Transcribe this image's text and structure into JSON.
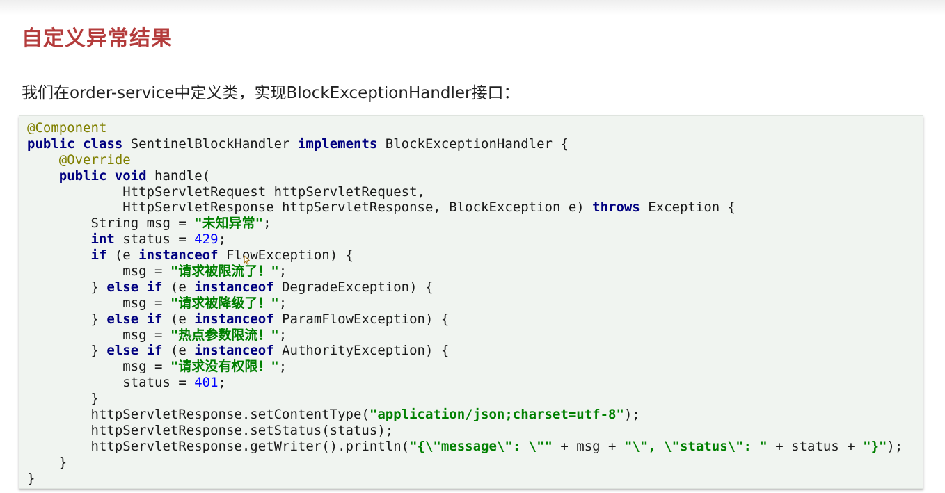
{
  "page": {
    "title": "自定义异常结果",
    "intro": "我们在order-service中定义类，实现BlockExceptionHandler接口："
  },
  "code": {
    "lines": [
      [
        {
          "t": "@Component",
          "c": "ann"
        }
      ],
      [
        {
          "t": "public ",
          "c": "kw"
        },
        {
          "t": "class ",
          "c": "kw"
        },
        {
          "t": "SentinelBlockHandler ",
          "c": ""
        },
        {
          "t": "implements ",
          "c": "kw"
        },
        {
          "t": "BlockExceptionHandler {",
          "c": ""
        }
      ],
      [
        {
          "t": "    ",
          "c": ""
        },
        {
          "t": "@Override",
          "c": "ann"
        }
      ],
      [
        {
          "t": "    ",
          "c": ""
        },
        {
          "t": "public ",
          "c": "kw"
        },
        {
          "t": "void ",
          "c": "kw"
        },
        {
          "t": "handle(",
          "c": ""
        }
      ],
      [
        {
          "t": "            HttpServletRequest httpServletRequest,",
          "c": ""
        }
      ],
      [
        {
          "t": "            HttpServletResponse httpServletResponse, BlockException e) ",
          "c": ""
        },
        {
          "t": "throws ",
          "c": "kw"
        },
        {
          "t": "Exception {",
          "c": ""
        }
      ],
      [
        {
          "t": "        String msg = ",
          "c": ""
        },
        {
          "t": "\"未知异常\"",
          "c": "str"
        },
        {
          "t": ";",
          "c": ""
        }
      ],
      [
        {
          "t": "        ",
          "c": ""
        },
        {
          "t": "int ",
          "c": "kw"
        },
        {
          "t": "status = ",
          "c": ""
        },
        {
          "t": "429",
          "c": "num"
        },
        {
          "t": ";",
          "c": ""
        }
      ],
      [
        {
          "t": "        ",
          "c": ""
        },
        {
          "t": "if ",
          "c": "kw"
        },
        {
          "t": "(e ",
          "c": ""
        },
        {
          "t": "instanceof ",
          "c": "kw"
        },
        {
          "t": "FlowException) {",
          "c": ""
        }
      ],
      [
        {
          "t": "            msg = ",
          "c": ""
        },
        {
          "t": "\"请求被限流了！\"",
          "c": "str"
        },
        {
          "t": ";",
          "c": ""
        }
      ],
      [
        {
          "t": "        } ",
          "c": ""
        },
        {
          "t": "else ",
          "c": "kw"
        },
        {
          "t": "if ",
          "c": "kw"
        },
        {
          "t": "(e ",
          "c": ""
        },
        {
          "t": "instanceof ",
          "c": "kw"
        },
        {
          "t": "DegradeException) {",
          "c": ""
        }
      ],
      [
        {
          "t": "            msg = ",
          "c": ""
        },
        {
          "t": "\"请求被降级了！\"",
          "c": "str"
        },
        {
          "t": ";",
          "c": ""
        }
      ],
      [
        {
          "t": "        } ",
          "c": ""
        },
        {
          "t": "else ",
          "c": "kw"
        },
        {
          "t": "if ",
          "c": "kw"
        },
        {
          "t": "(e ",
          "c": ""
        },
        {
          "t": "instanceof ",
          "c": "kw"
        },
        {
          "t": "ParamFlowException) {",
          "c": ""
        }
      ],
      [
        {
          "t": "            msg = ",
          "c": ""
        },
        {
          "t": "\"热点参数限流！\"",
          "c": "str"
        },
        {
          "t": ";",
          "c": ""
        }
      ],
      [
        {
          "t": "        } ",
          "c": ""
        },
        {
          "t": "else ",
          "c": "kw"
        },
        {
          "t": "if ",
          "c": "kw"
        },
        {
          "t": "(e ",
          "c": ""
        },
        {
          "t": "instanceof ",
          "c": "kw"
        },
        {
          "t": "AuthorityException) {",
          "c": ""
        }
      ],
      [
        {
          "t": "            msg = ",
          "c": ""
        },
        {
          "t": "\"请求没有权限！\"",
          "c": "str"
        },
        {
          "t": ";",
          "c": ""
        }
      ],
      [
        {
          "t": "            status = ",
          "c": ""
        },
        {
          "t": "401",
          "c": "num"
        },
        {
          "t": ";",
          "c": ""
        }
      ],
      [
        {
          "t": "        }",
          "c": ""
        }
      ],
      [
        {
          "t": "        httpServletResponse.setContentType(",
          "c": ""
        },
        {
          "t": "\"application/json;charset=utf-8\"",
          "c": "str"
        },
        {
          "t": ");",
          "c": ""
        }
      ],
      [
        {
          "t": "        httpServletResponse.setStatus(status);",
          "c": ""
        }
      ],
      [
        {
          "t": "        httpServletResponse.getWriter().println(",
          "c": ""
        },
        {
          "t": "\"{\\\"message\\\": \\\"\"",
          "c": "str"
        },
        {
          "t": " + msg + ",
          "c": ""
        },
        {
          "t": "\"\\\", \\\"status\\\": \"",
          "c": "str"
        },
        {
          "t": " + status + ",
          "c": ""
        },
        {
          "t": "\"}\"",
          "c": "str"
        },
        {
          "t": ");",
          "c": ""
        }
      ],
      [
        {
          "t": "    }",
          "c": ""
        }
      ],
      [
        {
          "t": "}",
          "c": ""
        }
      ]
    ]
  },
  "icons": {
    "cursor": "text-cursor-icon"
  }
}
